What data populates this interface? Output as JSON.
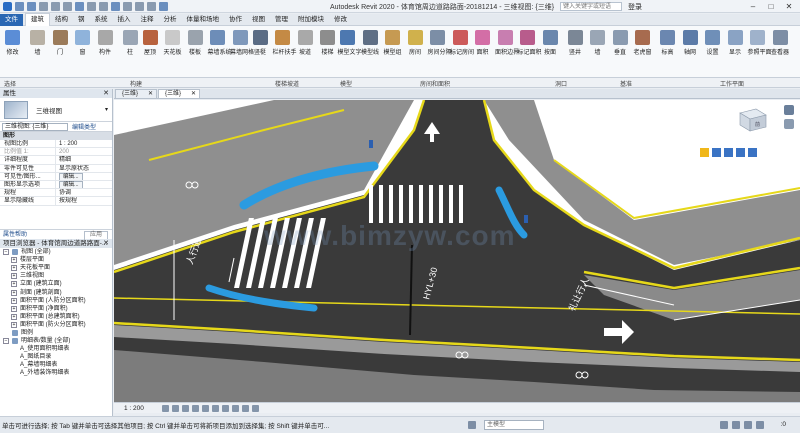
{
  "titlebar": {
    "title": "Autodesk Revit 2020 - 体育馆周边道路路面-20181214 - 三维视图: {三维}",
    "search_placeholder": "键入关键字或短语",
    "login": "登录"
  },
  "ribbon": {
    "tabs": [
      "文件",
      "建筑",
      "结构",
      "钢",
      "系统",
      "插入",
      "注释",
      "分析",
      "体量和场地",
      "协作",
      "视图",
      "管理",
      "附加模块",
      "修改"
    ],
    "active_tab": "建筑",
    "buttons": [
      {
        "label": "修改",
        "icon": "cursor-icon",
        "color": "#5b8dd6"
      },
      {
        "label": "墙",
        "icon": "wall-icon",
        "color": "#b8b1a5"
      },
      {
        "label": "门",
        "icon": "door-icon",
        "color": "#9b7b5a"
      },
      {
        "label": "窗",
        "icon": "window-icon",
        "color": "#8fb3db"
      },
      {
        "label": "构件",
        "icon": "component-icon",
        "color": "#a8a8a8"
      },
      {
        "label": "柱",
        "icon": "column-icon",
        "color": "#9aa6b5"
      },
      {
        "label": "屋顶",
        "icon": "roof-icon",
        "color": "#b8623e"
      },
      {
        "label": "天花板",
        "icon": "ceiling-icon",
        "color": "#c9c9c9"
      },
      {
        "label": "楼板",
        "icon": "floor-icon",
        "color": "#9aa3ad"
      },
      {
        "label": "幕墙系统",
        "icon": "curtain-system-icon",
        "color": "#6d8db8"
      },
      {
        "label": "幕墙网格",
        "icon": "curtain-grid-icon",
        "color": "#7e98bb"
      },
      {
        "label": "竖梃",
        "icon": "mullion-icon",
        "color": "#5a6c85"
      },
      {
        "label": "栏杆扶手",
        "icon": "railing-icon",
        "color": "#c48a45"
      },
      {
        "label": "坡道",
        "icon": "ramp-icon",
        "color": "#a9a9a9"
      },
      {
        "label": "楼梯",
        "icon": "stair-icon",
        "color": "#8d8d8d"
      },
      {
        "label": "模型文字",
        "icon": "model-text-icon",
        "color": "#4d78b0"
      },
      {
        "label": "模型线",
        "icon": "model-line-icon",
        "color": "#5f6f85"
      },
      {
        "label": "模型组",
        "icon": "model-group-icon",
        "color": "#c69a52"
      },
      {
        "label": "房间",
        "icon": "room-icon",
        "color": "#d0b14c"
      },
      {
        "label": "房间分隔",
        "icon": "room-separator-icon",
        "color": "#7c8ea6"
      },
      {
        "label": "标记房间",
        "icon": "tag-room-icon",
        "color": "#cc5a5a"
      },
      {
        "label": "面积",
        "icon": "area-icon",
        "color": "#d36ea6"
      },
      {
        "label": "面积边界",
        "icon": "area-boundary-icon",
        "color": "#c87eb0"
      },
      {
        "label": "标记面积",
        "icon": "tag-area-icon",
        "color": "#b85c8c"
      },
      {
        "label": "按面",
        "icon": "by-face-icon",
        "color": "#6a87ad"
      },
      {
        "label": "竖井",
        "icon": "shaft-icon",
        "color": "#7b8796"
      },
      {
        "label": "墙",
        "icon": "wall-opening-icon",
        "color": "#9aa6b5"
      },
      {
        "label": "垂直",
        "icon": "vertical-icon",
        "color": "#8a9bb0"
      },
      {
        "label": "老虎窗",
        "icon": "dormer-icon",
        "color": "#a76b4f"
      },
      {
        "label": "标高",
        "icon": "level-icon",
        "color": "#6b87b0"
      },
      {
        "label": "轴网",
        "icon": "grid-icon",
        "color": "#5b7ba8"
      },
      {
        "label": "设置",
        "icon": "set-workplane-icon",
        "color": "#6f8fb8"
      },
      {
        "label": "显示",
        "icon": "show-workplane-icon",
        "color": "#8aa3c4"
      },
      {
        "label": "参照平面",
        "icon": "ref-plane-icon",
        "color": "#9fb2cb"
      },
      {
        "label": "查看器",
        "icon": "viewer-icon",
        "color": "#7d8ea5"
      }
    ],
    "groups": [
      "选择",
      "构建",
      "楼梯坡道",
      "模型",
      "房间和面积",
      "洞口",
      "基准",
      "工作平面"
    ]
  },
  "properties": {
    "title": "属性",
    "type_name": "三维视图",
    "instance_select": "三维视图: {三维}",
    "edit_type": "编辑类型",
    "section_graphics": "图形",
    "rows": [
      {
        "k": "视图比例",
        "v": "1 : 200"
      },
      {
        "k": "比例值 1:",
        "v": "200",
        "gray": true
      },
      {
        "k": "详细程度",
        "v": "精细"
      },
      {
        "k": "零件可见性",
        "v": "显示原状态"
      },
      {
        "k": "可见性/图形...",
        "v": "编辑...",
        "btn": true
      },
      {
        "k": "图形显示选项",
        "v": "编辑...",
        "btn": true
      },
      {
        "k": "规程",
        "v": "协调"
      },
      {
        "k": "显示隐藏线",
        "v": "按规程"
      }
    ],
    "help_link": "属性帮助",
    "apply": "应用"
  },
  "browser": {
    "title": "项目浏览器 - 体育馆周边道路路面-...",
    "nodes": [
      {
        "label": "视图 (全部)",
        "level": 0,
        "pm": "−",
        "icon": "views-icon"
      },
      {
        "label": "楼层平面",
        "level": 1,
        "pm": "+"
      },
      {
        "label": "天花板平面",
        "level": 1,
        "pm": "+"
      },
      {
        "label": "三维视图",
        "level": 1,
        "pm": "+"
      },
      {
        "label": "立面 (建筑立面)",
        "level": 1,
        "pm": "+"
      },
      {
        "label": "剖面 (建筑剖面)",
        "level": 1,
        "pm": "+"
      },
      {
        "label": "面积平面 (人防分区面积)",
        "level": 1,
        "pm": "+"
      },
      {
        "label": "面积平面 (净面积)",
        "level": 1,
        "pm": "+"
      },
      {
        "label": "面积平面 (总建筑面积)",
        "level": 1,
        "pm": "+"
      },
      {
        "label": "面积平面 (防火分区面积)",
        "level": 1,
        "pm": "+"
      },
      {
        "label": "图例",
        "level": 0,
        "pm": "",
        "icon": "legend-icon"
      },
      {
        "label": "明细表/数量 (全部)",
        "level": 0,
        "pm": "−",
        "icon": "schedule-icon"
      },
      {
        "label": "A_使用面积明细表",
        "level": 1,
        "pm": ""
      },
      {
        "label": "A_图纸目录",
        "level": 1,
        "pm": ""
      },
      {
        "label": "A_幕墙明细表",
        "level": 1,
        "pm": ""
      },
      {
        "label": "A_外墙装饰明细表",
        "level": 1,
        "pm": ""
      }
    ]
  },
  "viewtabs": [
    {
      "label": "{三维}",
      "active": false
    },
    {
      "label": "{三维}",
      "active": true
    }
  ],
  "canvas": {
    "watermark": "www.bimzyw.com",
    "road_markings": [
      "人行道",
      "HYL+30",
      "礼让行人"
    ],
    "viewcube_label": "前"
  },
  "viewbar": {
    "scale": "1 : 200"
  },
  "statusbar": {
    "text": "单击可进行选择; 按 Tab 键并单击可选择其他项目; 按 Ctrl 键并单击可将新项目添加到选择集; 按 Shift 键并单击可...",
    "model_select": "主模型",
    "filter_count": ":0"
  }
}
